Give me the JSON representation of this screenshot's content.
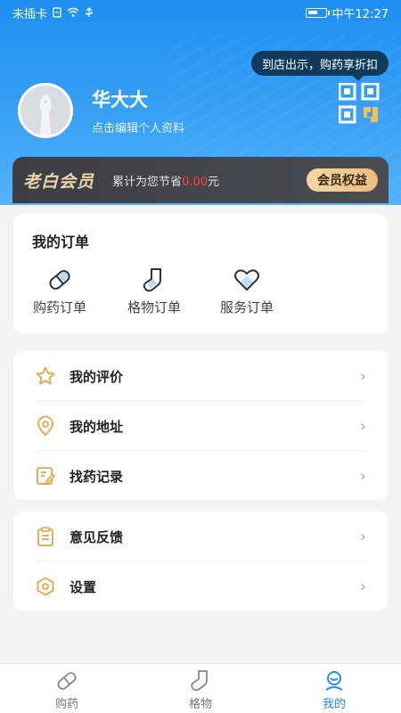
{
  "status_bar": {
    "carrier": "未插卡",
    "time": "中午12:27"
  },
  "profile": {
    "name": "华大大",
    "edit_hint": "点击编辑个人资料",
    "qr_tip": "到店出示，购药享折扣"
  },
  "member": {
    "tag": "老白会员",
    "saved_prefix": "累计为您节省",
    "saved_amount": "0.00",
    "saved_suffix": "元",
    "benefit_button": "会员权益"
  },
  "orders": {
    "title": "我的订单",
    "items": [
      {
        "label": "购药订单",
        "icon": "pill-icon"
      },
      {
        "label": "格物订单",
        "icon": "sock-icon"
      },
      {
        "label": "服务订单",
        "icon": "heart-icon"
      }
    ]
  },
  "menu_group1": [
    {
      "label": "我的评价",
      "icon": "star-icon"
    },
    {
      "label": "我的地址",
      "icon": "location-icon"
    },
    {
      "label": "找药记录",
      "icon": "edit-record-icon"
    }
  ],
  "menu_group2": [
    {
      "label": "意见反馈",
      "icon": "feedback-icon"
    },
    {
      "label": "设置",
      "icon": "settings-icon"
    }
  ],
  "bottom_nav": [
    {
      "label": "购药",
      "icon": "pill-icon",
      "active": false
    },
    {
      "label": "格物",
      "icon": "sock-icon",
      "active": false
    },
    {
      "label": "我的",
      "icon": "user-icon",
      "active": true
    }
  ],
  "colors": {
    "primary": "#1e8ff0",
    "accent_orange": "#f0a041",
    "price_red": "#ff4a3d",
    "member_gold": "#ecd4a8"
  }
}
